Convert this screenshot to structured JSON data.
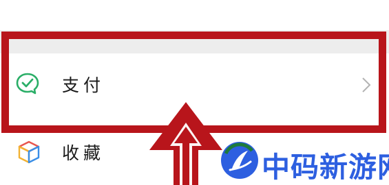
{
  "settings_list": {
    "items": [
      {
        "label": "支付",
        "icon": "wechat-pay-icon",
        "icon_color": "#2aae67",
        "has_chevron": true
      },
      {
        "label": "收藏",
        "icon": "favorites-cube-icon",
        "icon_colors": [
          "#f2b233",
          "#3a8ee6",
          "#e8554e"
        ]
      }
    ]
  },
  "annotation": {
    "highlight_color": "#b8151b",
    "arrow_color": "#b8151b"
  },
  "watermark": {
    "text": "中码新游网",
    "color": "#2d5fe0"
  }
}
